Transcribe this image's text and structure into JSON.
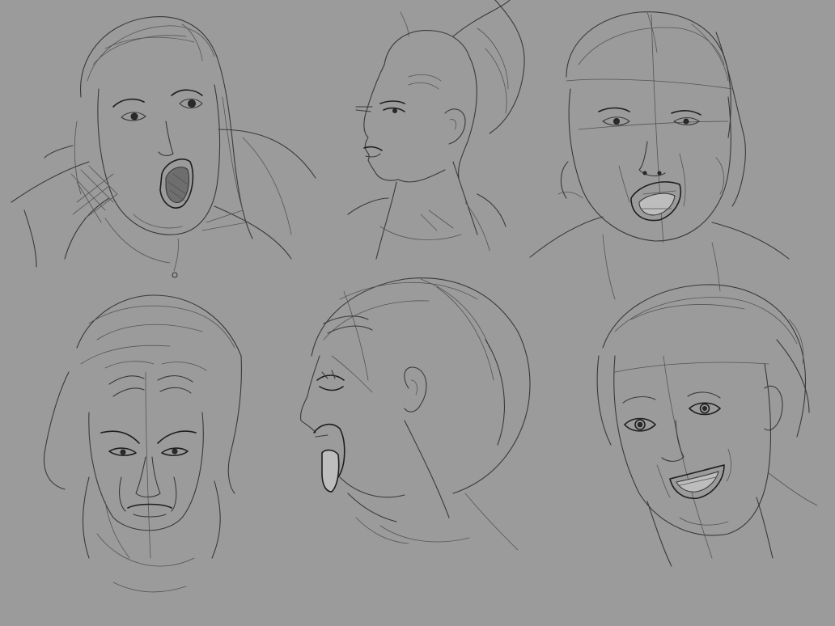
{
  "artwork": {
    "background_color": "#9b9b9b",
    "line_color": "#3c3c3c",
    "sketches": [
      {
        "id": "surprised-woman-open-mouth"
      },
      {
        "id": "profile-woman-updo"
      },
      {
        "id": "woman-shouting-front"
      },
      {
        "id": "frowning-face-front"
      },
      {
        "id": "screaming-profile-tongue"
      },
      {
        "id": "smiling-woman-wide-eyes"
      }
    ]
  }
}
